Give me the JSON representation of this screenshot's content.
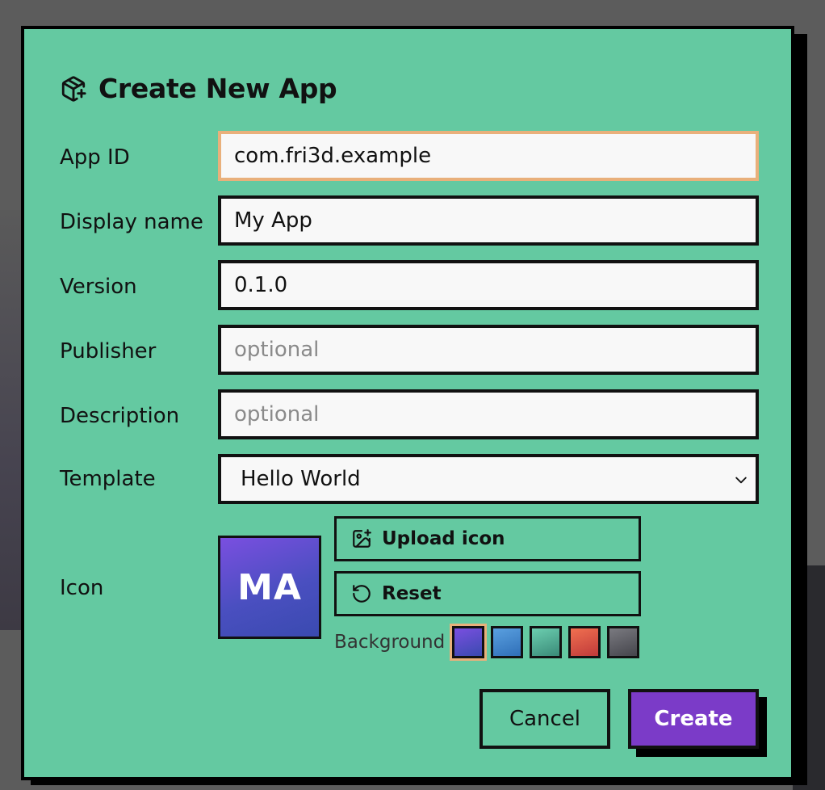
{
  "dialog": {
    "title": "Create New App",
    "title_icon": "package-plus-icon"
  },
  "fields": {
    "app_id": {
      "label": "App ID",
      "value": "com.fri3d.example",
      "placeholder": ""
    },
    "display_name": {
      "label": "Display name",
      "value": "My App",
      "placeholder": ""
    },
    "version": {
      "label": "Version",
      "value": "0.1.0",
      "placeholder": ""
    },
    "publisher": {
      "label": "Publisher",
      "value": "",
      "placeholder": "optional"
    },
    "description": {
      "label": "Description",
      "value": "",
      "placeholder": "optional"
    },
    "template": {
      "label": "Template",
      "selected": "Hello World"
    }
  },
  "icon": {
    "label": "Icon",
    "preview_text": "MA",
    "upload_label": "Upload icon",
    "upload_icon": "image-plus-icon",
    "reset_label": "Reset",
    "reset_icon": "rotate-ccw-icon",
    "background_label": "Background",
    "swatches": [
      {
        "name": "purple",
        "from": "#7a4fe0",
        "to": "#3a4ab0",
        "selected": true
      },
      {
        "name": "blue",
        "from": "#5aa0e0",
        "to": "#2f6fb8",
        "selected": false
      },
      {
        "name": "teal",
        "from": "#6ccfb0",
        "to": "#3a8a78",
        "selected": false
      },
      {
        "name": "red",
        "from": "#f07050",
        "to": "#c03a3a",
        "selected": false
      },
      {
        "name": "gray",
        "from": "#7a7a80",
        "to": "#45454c",
        "selected": false
      }
    ]
  },
  "actions": {
    "cancel_label": "Cancel",
    "create_label": "Create"
  },
  "colors": {
    "dialog_bg": "#64c9a1",
    "accent": "#7b3bc8",
    "focus": "#e9b07b"
  }
}
